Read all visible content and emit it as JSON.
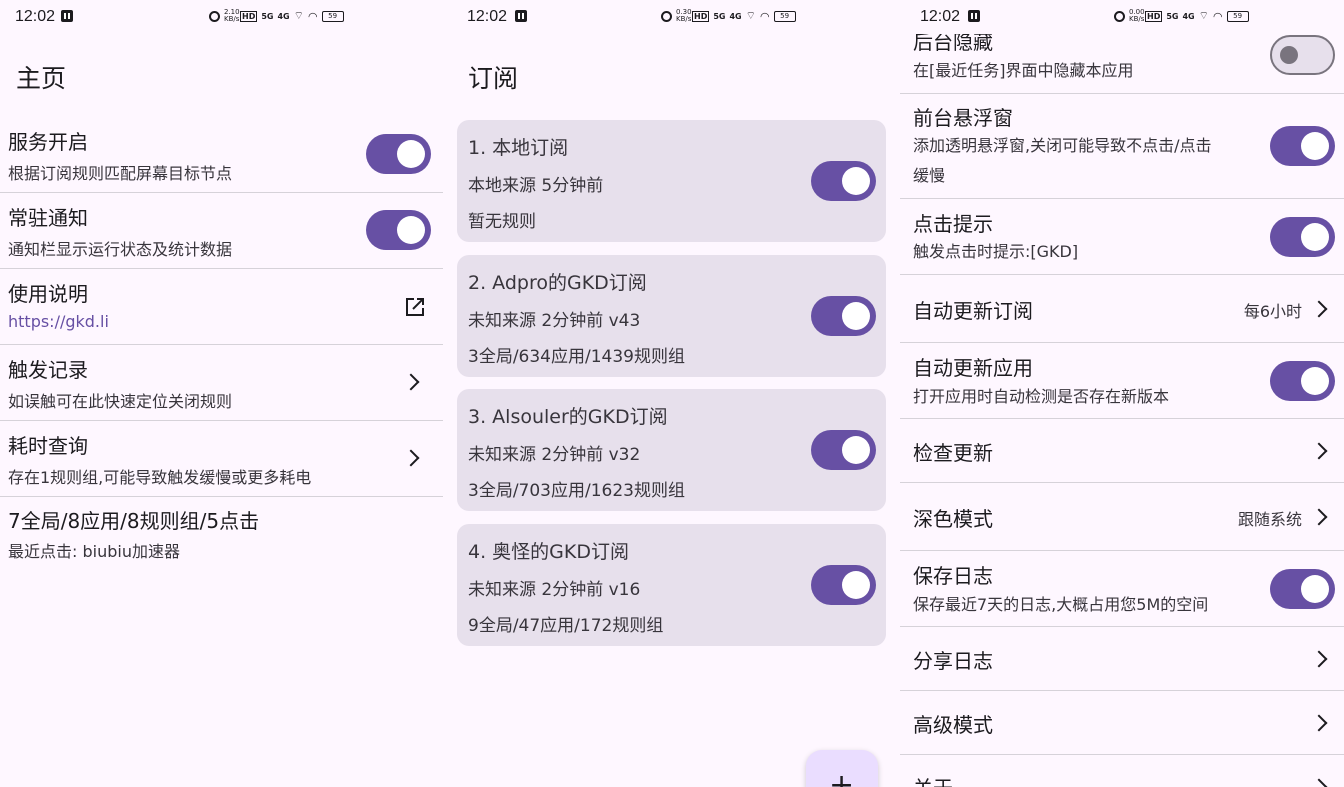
{
  "status": {
    "time": "12:02",
    "speed1": "2.10 KB/s",
    "speed2": "0.30 KB/s",
    "speed3": "0.00 KB/s",
    "battery": "59",
    "hd": "HD",
    "sig1": "5G",
    "sig2": "4G"
  },
  "home": {
    "title": "主页",
    "rows": [
      {
        "title": "服务开启",
        "sub": "根据订阅规则匹配屏幕目标节点"
      },
      {
        "title": "常驻通知",
        "sub": "通知栏显示运行状态及统计数据"
      },
      {
        "title": "使用说明",
        "sub": "https://gkd.li"
      },
      {
        "title": "触发记录",
        "sub": "如误触可在此快速定位关闭规则"
      },
      {
        "title": "耗时查询",
        "sub": "存在1规则组,可能导致触发缓慢或更多耗电"
      },
      {
        "title": "7全局/8应用/8规则组/5点击",
        "sub": "最近点击: biubiu加速器"
      }
    ]
  },
  "subs": {
    "title": "订阅",
    "cards": [
      {
        "title": "1. 本地订阅",
        "meta": "本地来源   5分钟前",
        "rules": "暂无规则"
      },
      {
        "title": "2. Adpro的GKD订阅",
        "meta": "未知来源   2分钟前   v43",
        "rules": "3全局/634应用/1439规则组"
      },
      {
        "title": "3. Alsouler的GKD订阅",
        "meta": "未知来源   2分钟前   v32",
        "rules": "3全局/703应用/1623规则组"
      },
      {
        "title": "4. 奥怪的GKD订阅",
        "meta": "未知来源   2分钟前   v16",
        "rules": "9全局/47应用/172规则组"
      }
    ],
    "fab": "+"
  },
  "settings": {
    "rows": [
      {
        "title": "后台隐藏",
        "sub": "在[最近任务]界面中隐藏本应用"
      },
      {
        "title": "前台悬浮窗",
        "sub": "添加透明悬浮窗,关闭可能导致不点击/点击",
        "sub2": "缓慢"
      },
      {
        "title": "点击提示",
        "sub": "触发点击时提示:[GKD]"
      },
      {
        "title": "自动更新订阅",
        "value": "每6小时"
      },
      {
        "title": "自动更新应用",
        "sub": "打开应用时自动检测是否存在新版本"
      },
      {
        "title": "检查更新"
      },
      {
        "title": "深色模式",
        "value": "跟随系统"
      },
      {
        "title": "保存日志",
        "sub": "保存最近7天的日志,大概占用您5M的空间"
      },
      {
        "title": "分享日志"
      },
      {
        "title": "高级模式"
      },
      {
        "title": "关于"
      }
    ]
  }
}
